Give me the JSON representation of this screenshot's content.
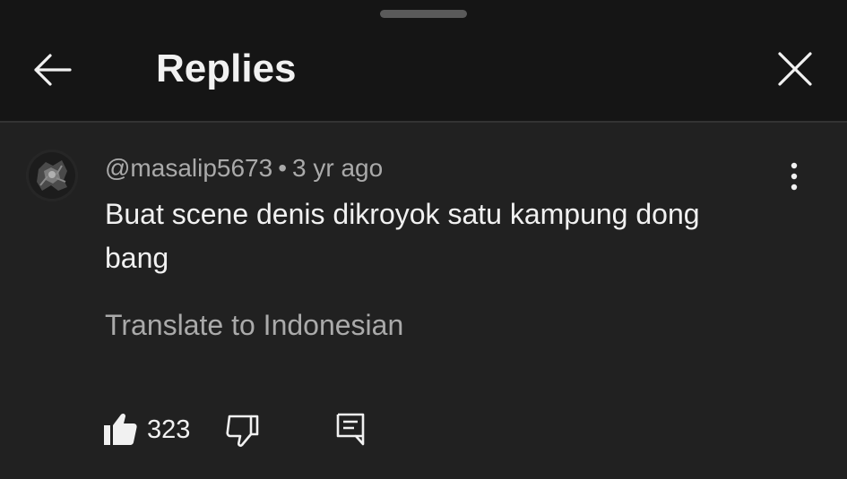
{
  "header": {
    "title": "Replies"
  },
  "comment": {
    "author": "@masalip5673",
    "separator": "•",
    "time": "3 yr ago",
    "text": "Buat scene denis dikroyok satu kampung dong bang",
    "translate_label": "Translate to Indonesian",
    "like_count": "323"
  },
  "icons": {
    "back": "arrow-back-icon",
    "close": "close-icon",
    "more": "more-vertical-icon",
    "like": "thumb-up-icon",
    "dislike": "thumb-down-icon",
    "reply": "comment-reply-icon"
  },
  "colors": {
    "header_bg": "#151515",
    "body_bg": "#212121",
    "primary_text": "#f1f1f1",
    "secondary_text": "#aaaaaa"
  }
}
